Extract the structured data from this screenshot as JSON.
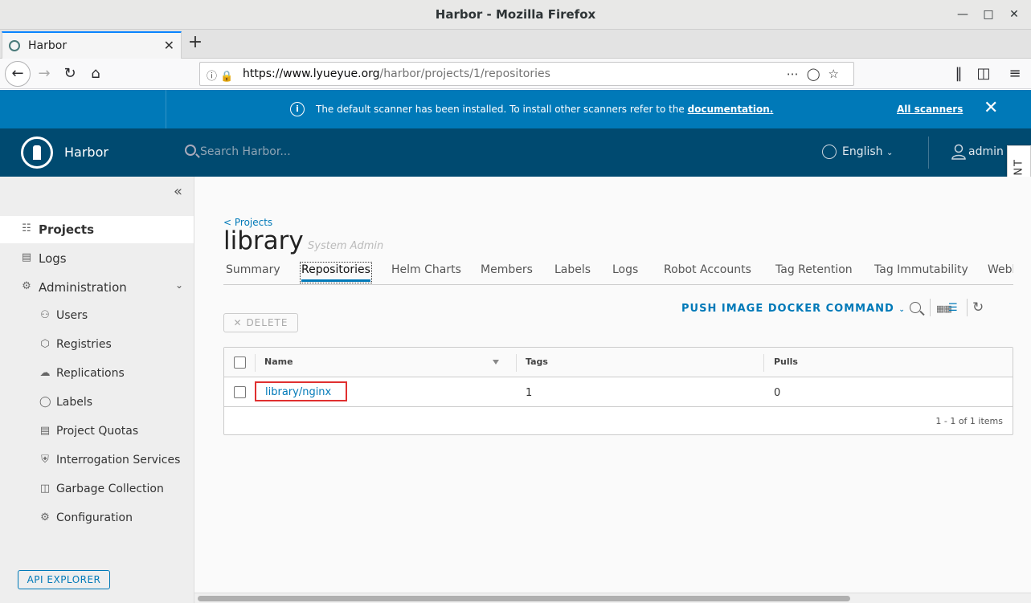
{
  "window": {
    "title": "Harbor - Mozilla Firefox"
  },
  "browser": {
    "tab_label": "Harbor",
    "url_domain": "https://www.lyueyue.org",
    "url_path": "/harbor/projects/1/repositories"
  },
  "banner": {
    "message": "The default scanner has been installed. To install other scanners refer to the ",
    "doc_link": "documentation.",
    "all_scanners": "All scanners"
  },
  "header": {
    "brand": "Harbor",
    "search_placeholder": "Search Harbor...",
    "language": "English",
    "user": "admin",
    "event_tab": "EVENT"
  },
  "sidebar": {
    "items": [
      {
        "label": "Projects",
        "icon": "projects-icon",
        "active": true
      },
      {
        "label": "Logs",
        "icon": "logs-icon"
      },
      {
        "label": "Administration",
        "icon": "administration-icon"
      }
    ],
    "admin_items": [
      {
        "label": "Users",
        "icon": "users-icon"
      },
      {
        "label": "Registries",
        "icon": "registries-icon"
      },
      {
        "label": "Replications",
        "icon": "replications-icon"
      },
      {
        "label": "Labels",
        "icon": "labels-icon"
      },
      {
        "label": "Project Quotas",
        "icon": "quotas-icon"
      },
      {
        "label": "Interrogation Services",
        "icon": "shield-icon"
      },
      {
        "label": "Garbage Collection",
        "icon": "trash-icon"
      },
      {
        "label": "Configuration",
        "icon": "gear-icon"
      }
    ],
    "api_explorer": "API EXPLORER"
  },
  "main": {
    "back_link": "< Projects",
    "project_name": "library",
    "role": "System Admin",
    "tabs": [
      "Summary",
      "Repositories",
      "Helm Charts",
      "Members",
      "Labels",
      "Logs",
      "Robot Accounts",
      "Tag Retention",
      "Tag Immutability",
      "Webhooks"
    ],
    "push_command": "PUSH IMAGE DOCKER COMMAND",
    "delete_label": "DELETE",
    "columns": [
      "Name",
      "Tags",
      "Pulls"
    ],
    "rows": [
      {
        "name": "library/nginx",
        "tags": "1",
        "pulls": "0"
      }
    ],
    "footer": "1 - 1 of 1 items"
  },
  "colors": {
    "accent": "#0079b8",
    "header": "#004a70",
    "highlight": "#e03030"
  }
}
